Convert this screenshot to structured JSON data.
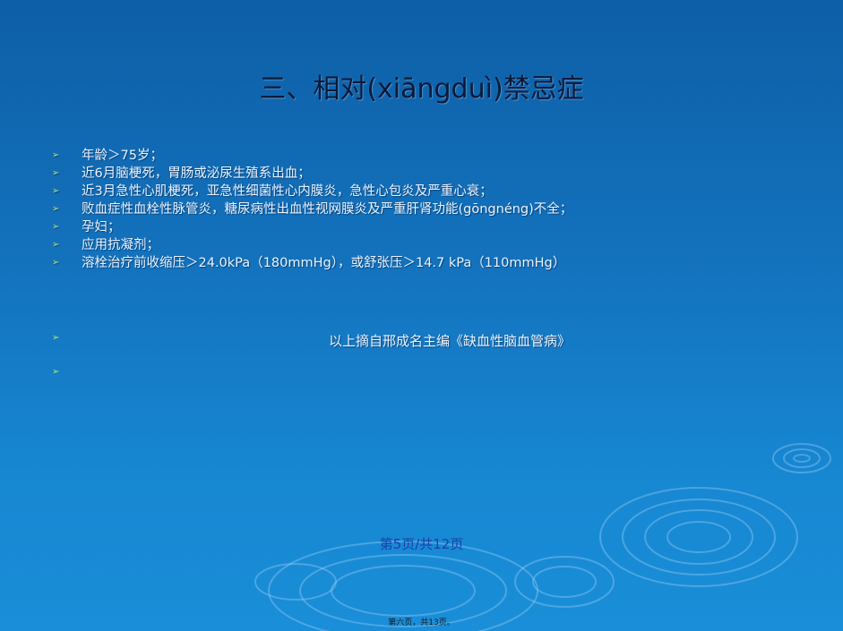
{
  "slide": {
    "title": "三、相对(xiāngduì)禁忌症",
    "bullets": [
      "年龄＞75岁；",
      "近6月脑梗死，胃肠或泌尿生殖系出血；",
      "近3月急性心肌梗死，亚急性细菌性心内膜炎，急性心包炎及严重心衰；",
      "败血症性血栓性脉管炎，糖尿病性出血性视网膜炎及严重肝肾功能(gōngnéng)不全；",
      "孕妇；",
      "应用抗凝剂；",
      "溶栓治疗前收缩压＞24.0kPa（180mmHg），或舒张压＞14.7 kPa（110mmHg）"
    ],
    "source": "以上摘自邢成名主编《缺血性脑血管病》",
    "bullet_symbol": "➢",
    "page_indicator": "第5页/共12页",
    "footer_note": "第六页，共13页。"
  },
  "colors": {
    "background_top": "#0d5fa6",
    "background_bottom": "#1a8ed8",
    "title": "#0a1a3a",
    "body_text": "#eaf3ff",
    "bullet": "#b8e07a",
    "page_indicator": "#1c3fa8"
  }
}
